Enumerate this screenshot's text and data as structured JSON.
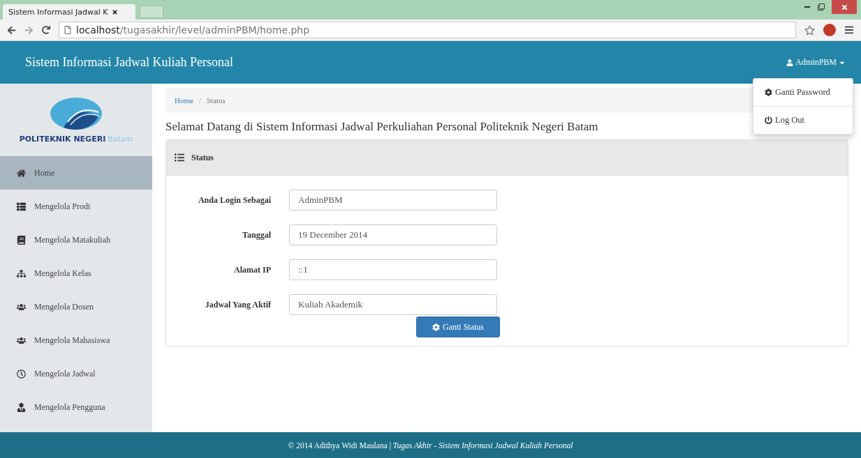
{
  "browser": {
    "tab_title": "Sistem Informasi Jadwal K",
    "url_host": "localhost",
    "url_path": "/tugasakhir/level/adminPBM/home.php"
  },
  "navbar": {
    "brand": "Sistem Informasi Jadwal Kuliah Personal",
    "user": "AdminPBM",
    "menu_open": true,
    "menu": [
      {
        "label": "Ganti Password"
      },
      {
        "label": "Log Out"
      }
    ]
  },
  "sidebar": {
    "logo_name": "POLITEKNIK NEGERI",
    "logo_city": "Batam",
    "items": [
      {
        "label": "Home",
        "selected": true
      },
      {
        "label": "Mengelola Prodi",
        "selected": false
      },
      {
        "label": "Mengelola Matakuliah",
        "selected": false
      },
      {
        "label": "Mengelola Kelas",
        "selected": false
      },
      {
        "label": "Mengelola Dosen",
        "selected": false
      },
      {
        "label": "Mengelola Mahasiswa",
        "selected": false
      },
      {
        "label": "Mengelola Jadwal",
        "selected": false
      },
      {
        "label": "Mengelola Pengguna",
        "selected": false
      }
    ]
  },
  "breadcrumb": {
    "items": [
      "Home",
      "Status"
    ],
    "separator": "/"
  },
  "heading": "Selamat Datang di Sistem Informasi Jadwal Perkuliahan Personal Politeknik Negeri Batam",
  "panel": {
    "title": "Status",
    "fields": [
      {
        "label": "Anda Login Sebagai",
        "value": "AdminPBM"
      },
      {
        "label": "Tanggal",
        "value": "19 December 2014"
      },
      {
        "label": "Alamat IP",
        "value": "::1"
      },
      {
        "label": "Jadwal Yang Aktif",
        "value": "Kuliah Akademik"
      }
    ],
    "button": "Ganti Status"
  },
  "footer": "© 2014 Adithya Widi Maulana | *Tugas Akhir - Sistem Informasi Jadwal Kuliah Personal*"
}
